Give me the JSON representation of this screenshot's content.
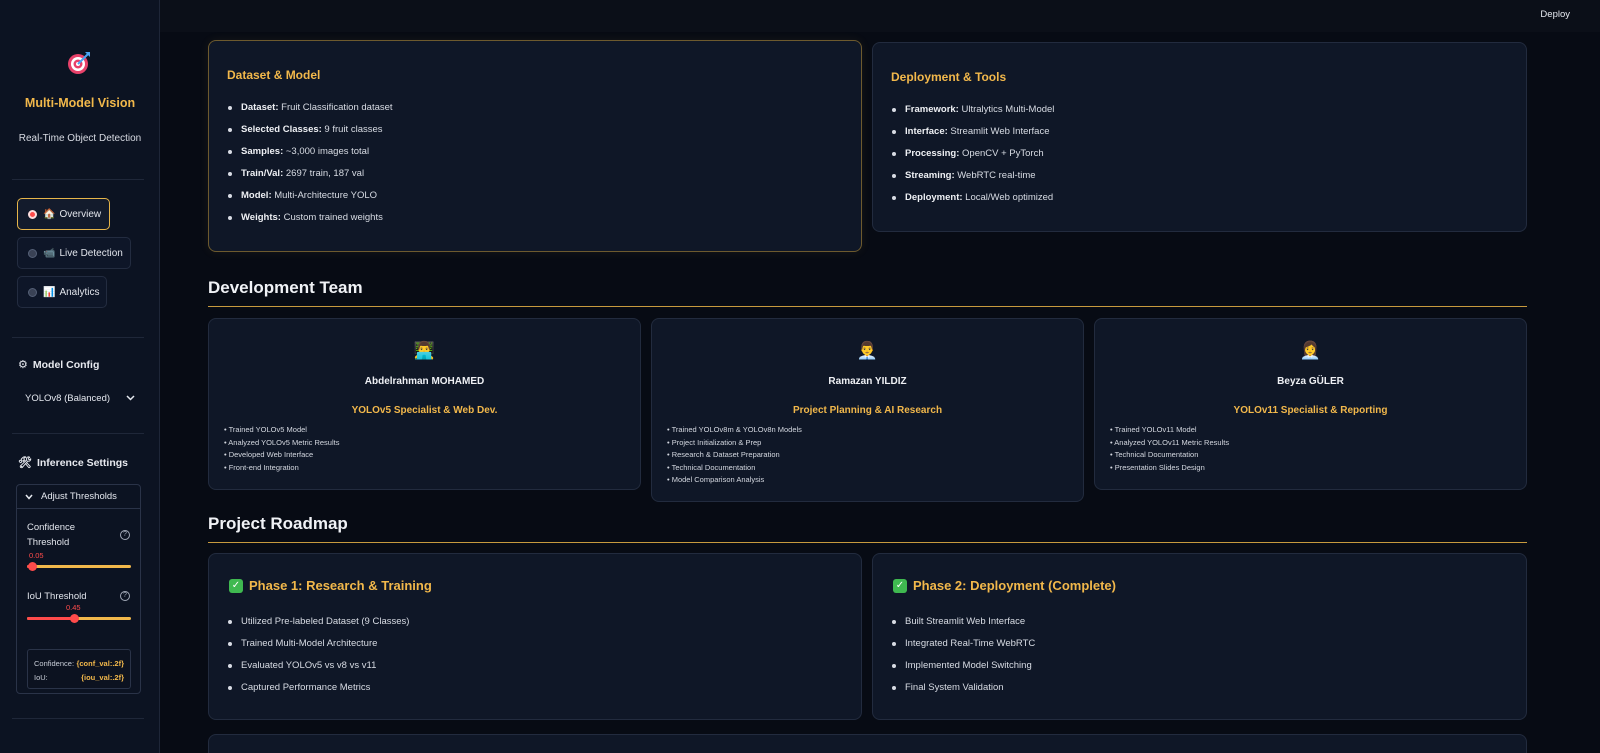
{
  "sidebar": {
    "title": "Multi-Model Vision",
    "subtitle": "Real-Time Object Detection",
    "nav": [
      {
        "icon": "🏠",
        "label": "Overview",
        "active": true
      },
      {
        "icon": "📹",
        "label": "Live Detection",
        "active": false
      },
      {
        "icon": "📊",
        "label": "Analytics",
        "active": false
      }
    ],
    "model_config_icon": "⚙",
    "model_config_label": "Model Config",
    "model_select": "YOLOv8 (Balanced)",
    "inference_icon": "🛠",
    "inference_label": "Inference Settings",
    "expander_label": "Adjust Thresholds",
    "confidence_label": "Confidence Threshold",
    "confidence_value": "0.05",
    "iou_label": "IoU Threshold",
    "iou_value": "0.45",
    "summary_conf_key": "Confidence:",
    "summary_conf_val": "{conf_val:.2f}",
    "summary_iou_key": "IoU:",
    "summary_iou_val": "{iou_val:.2f}"
  },
  "topbar": {
    "deploy": "Deploy"
  },
  "dataset_card": {
    "title": "Dataset & Model",
    "items": [
      {
        "k": "Dataset:",
        "v": " Fruit Classification dataset"
      },
      {
        "k": "Selected Classes:",
        "v": " 9 fruit classes"
      },
      {
        "k": "Samples:",
        "v": " ~3,000 images total"
      },
      {
        "k": "Train/Val:",
        "v": " 2697 train, 187 val"
      },
      {
        "k": "Model:",
        "v": " Multi-Architecture YOLO"
      },
      {
        "k": "Weights:",
        "v": " Custom trained weights"
      }
    ]
  },
  "deploy_card": {
    "title": "Deployment & Tools",
    "items": [
      {
        "k": "Framework:",
        "v": " Ultralytics Multi-Model"
      },
      {
        "k": "Interface:",
        "v": " Streamlit Web Interface"
      },
      {
        "k": "Processing:",
        "v": " OpenCV + PyTorch"
      },
      {
        "k": "Streaming:",
        "v": " WebRTC real-time"
      },
      {
        "k": "Deployment:",
        "v": " Local/Web optimized"
      }
    ]
  },
  "team_section": "Development Team",
  "team": [
    {
      "avatar": "👨‍💻",
      "name": "Abdelrahman MOHAMED",
      "role": "YOLOv5 Specialist & Web Dev.",
      "tasks": [
        "Trained YOLOv5 Model",
        "Analyzed YOLOv5 Metric Results",
        "Developed Web Interface",
        "Front-end Integration"
      ]
    },
    {
      "avatar": "👨‍💼",
      "name": "Ramazan YILDIZ",
      "role": "Project Planning & AI Research",
      "tasks": [
        "Trained YOLOv8m & YOLOv8n Models",
        "Project Initialization & Prep",
        "Research & Dataset Preparation",
        "Technical Documentation",
        "Model Comparison Analysis"
      ]
    },
    {
      "avatar": "👩‍💼",
      "name": "Beyza GÜLER",
      "role": "YOLOv11 Specialist & Reporting",
      "tasks": [
        "Trained YOLOv11 Model",
        "Analyzed YOLOv11 Metric Results",
        "Technical Documentation",
        "Presentation Slides Design"
      ]
    }
  ],
  "roadmap_section": "Project Roadmap",
  "phases": [
    {
      "title": "Phase 1: Research & Training",
      "items": [
        "Utilized Pre-labeled Dataset (9 Classes)",
        "Trained Multi-Model Architecture",
        "Evaluated YOLOv5 vs v8 vs v11",
        "Captured Performance Metrics"
      ]
    },
    {
      "title": "Phase 2: Deployment (Complete)",
      "items": [
        "Built Streamlit Web Interface",
        "Integrated Real-Time WebRTC",
        "Implemented Model Switching",
        "Final System Validation"
      ]
    }
  ],
  "colors": {
    "accent": "#f2b84b",
    "primary": "#ff4b4b",
    "background": "#070b14",
    "card": "#0f1727"
  }
}
